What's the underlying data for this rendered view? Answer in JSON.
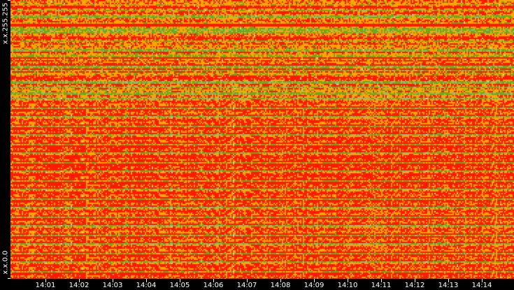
{
  "chart_data": {
    "type": "heatmap",
    "title": "",
    "xlabel": "",
    "ylabel": "",
    "y_tick_labels": [
      "x.x.255.255",
      "x.x.0.0"
    ],
    "x_tick_labels": [
      "14:01",
      "14:02",
      "14:03",
      "14:04",
      "14:05",
      "14:06",
      "14:07",
      "14:08",
      "14:09",
      "14:10",
      "14:11",
      "14:12",
      "14:13",
      "14:14"
    ],
    "color_scale": [
      "#c8d8c0",
      "#8cc07a",
      "#6aaa1e",
      "#ffa500",
      "#ff1a00"
    ],
    "grid": false
  }
}
